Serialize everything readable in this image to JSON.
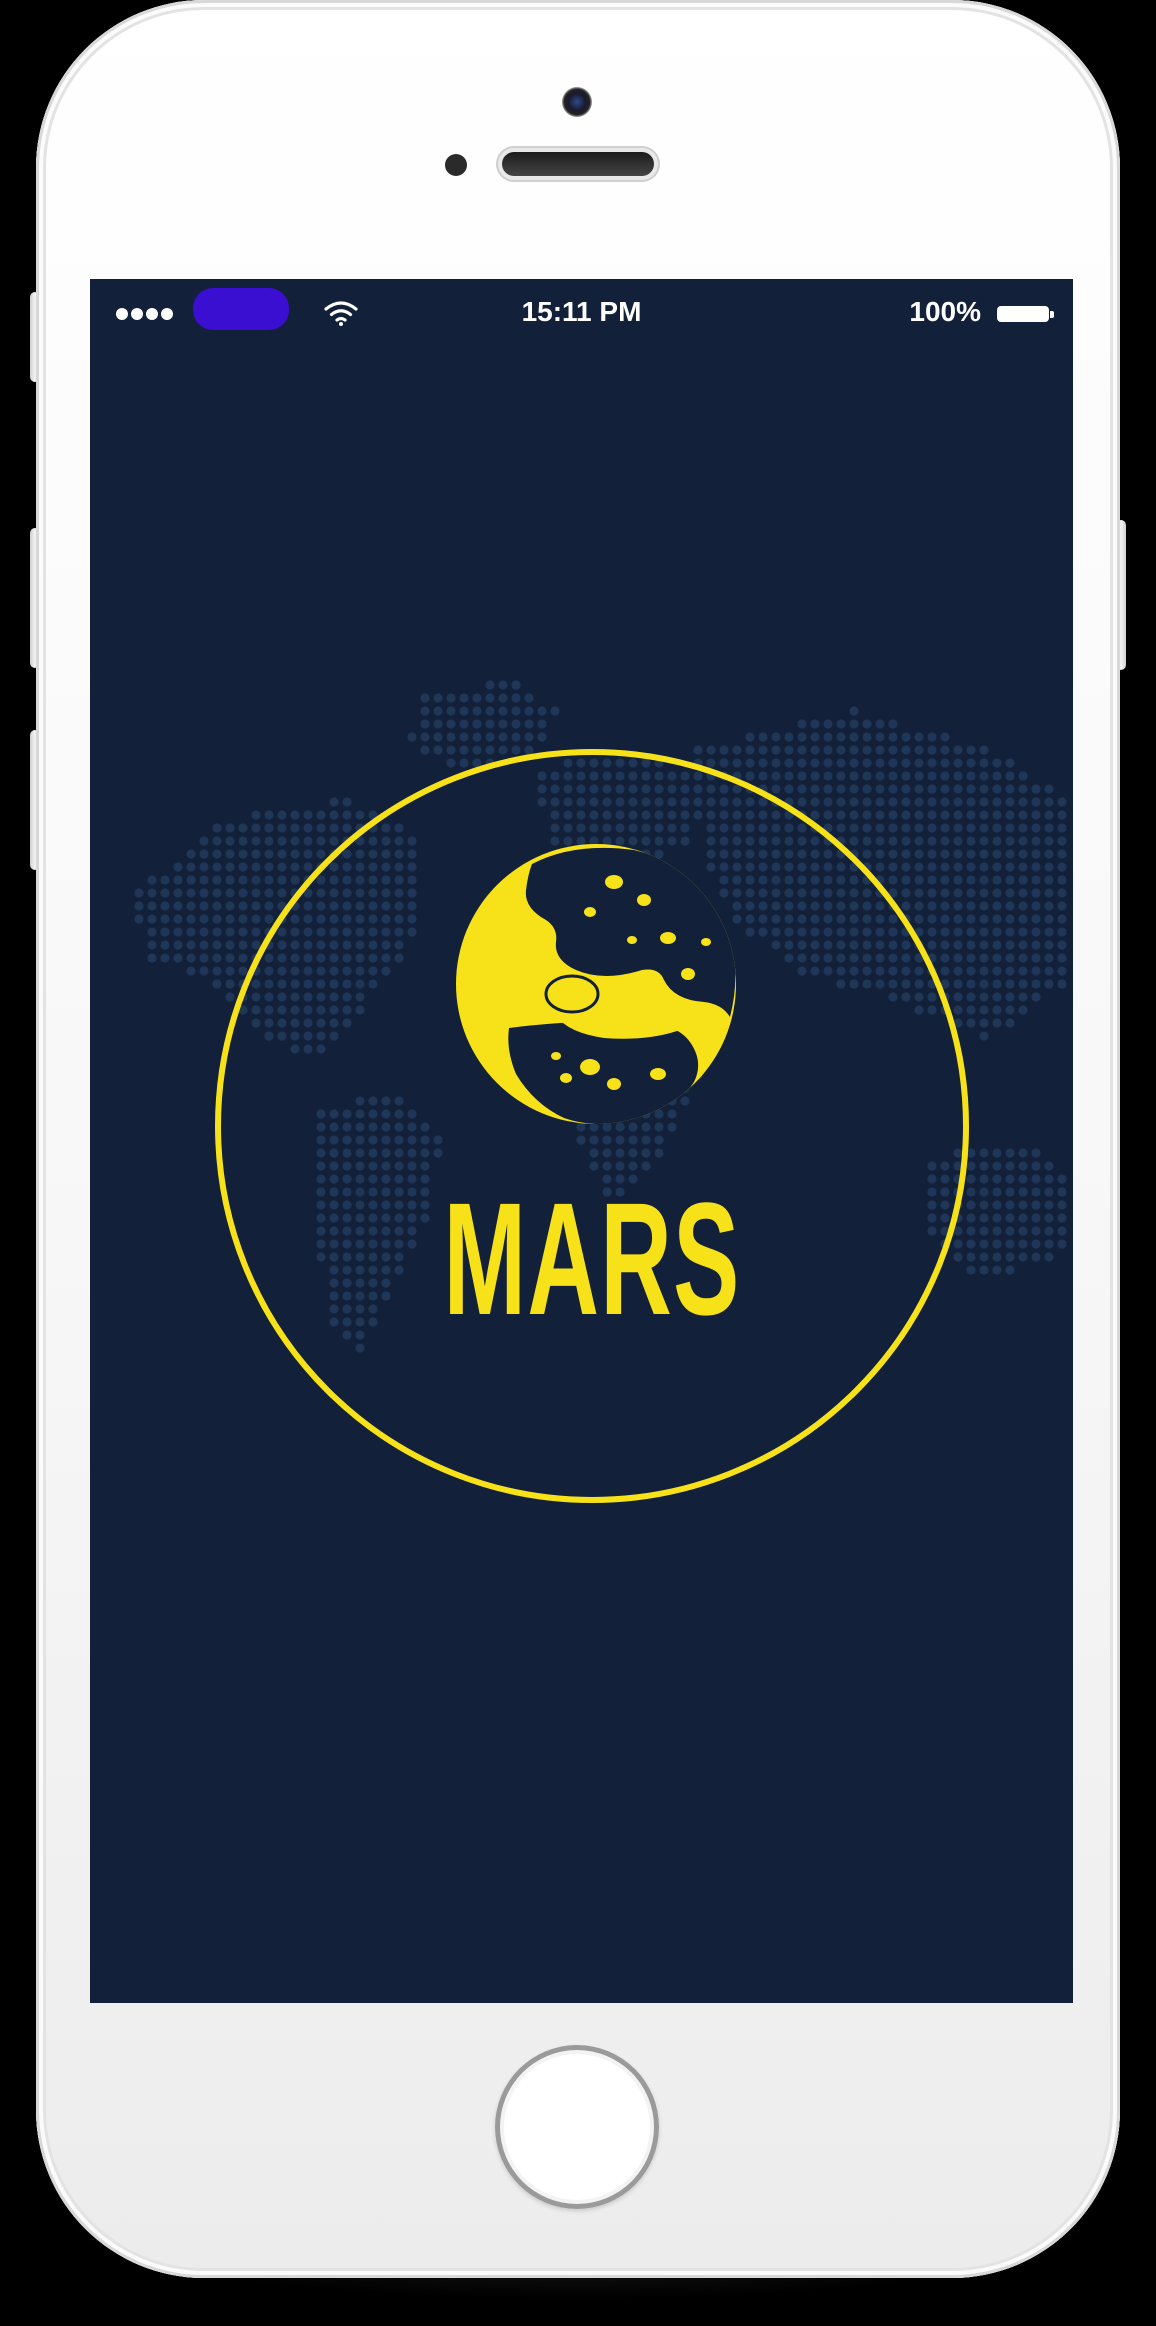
{
  "status_bar": {
    "time": "15:11 PM",
    "battery_percent": "100%",
    "signal_bars": 4,
    "wifi_icon": "wifi-icon",
    "battery_icon": "battery-full-icon"
  },
  "splash": {
    "brand": "MARS",
    "logo_icon": "planet-icon",
    "background_pattern": "dotted-world-map"
  },
  "colors": {
    "background": "#122139",
    "accent": "#f7e21a",
    "map_dots": "#1f3656",
    "carrier_redaction": "#3a0fd1"
  }
}
